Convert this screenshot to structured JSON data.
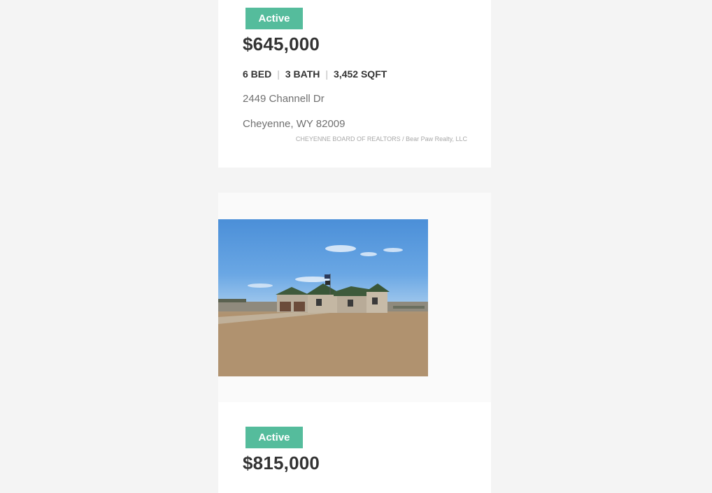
{
  "listings": [
    {
      "status": "Active",
      "price": "$645,000",
      "beds": "6 BED",
      "baths": "3 BATH",
      "sqft": "3,452 SQFT",
      "address_line1": "2449 Channell Dr",
      "address_line2": "Cheyenne, WY 82009",
      "credit": "CHEYENNE BOARD OF REALTORS / Bear Paw Realty, LLC"
    },
    {
      "status": "Active",
      "price": "$815,000",
      "photo": "house-photo"
    }
  ],
  "colors": {
    "page_bg": "#f4f4f4",
    "badge_green": "#55bc9c",
    "price_text": "#333333",
    "address_text": "#707070"
  },
  "spec_separator": "|"
}
